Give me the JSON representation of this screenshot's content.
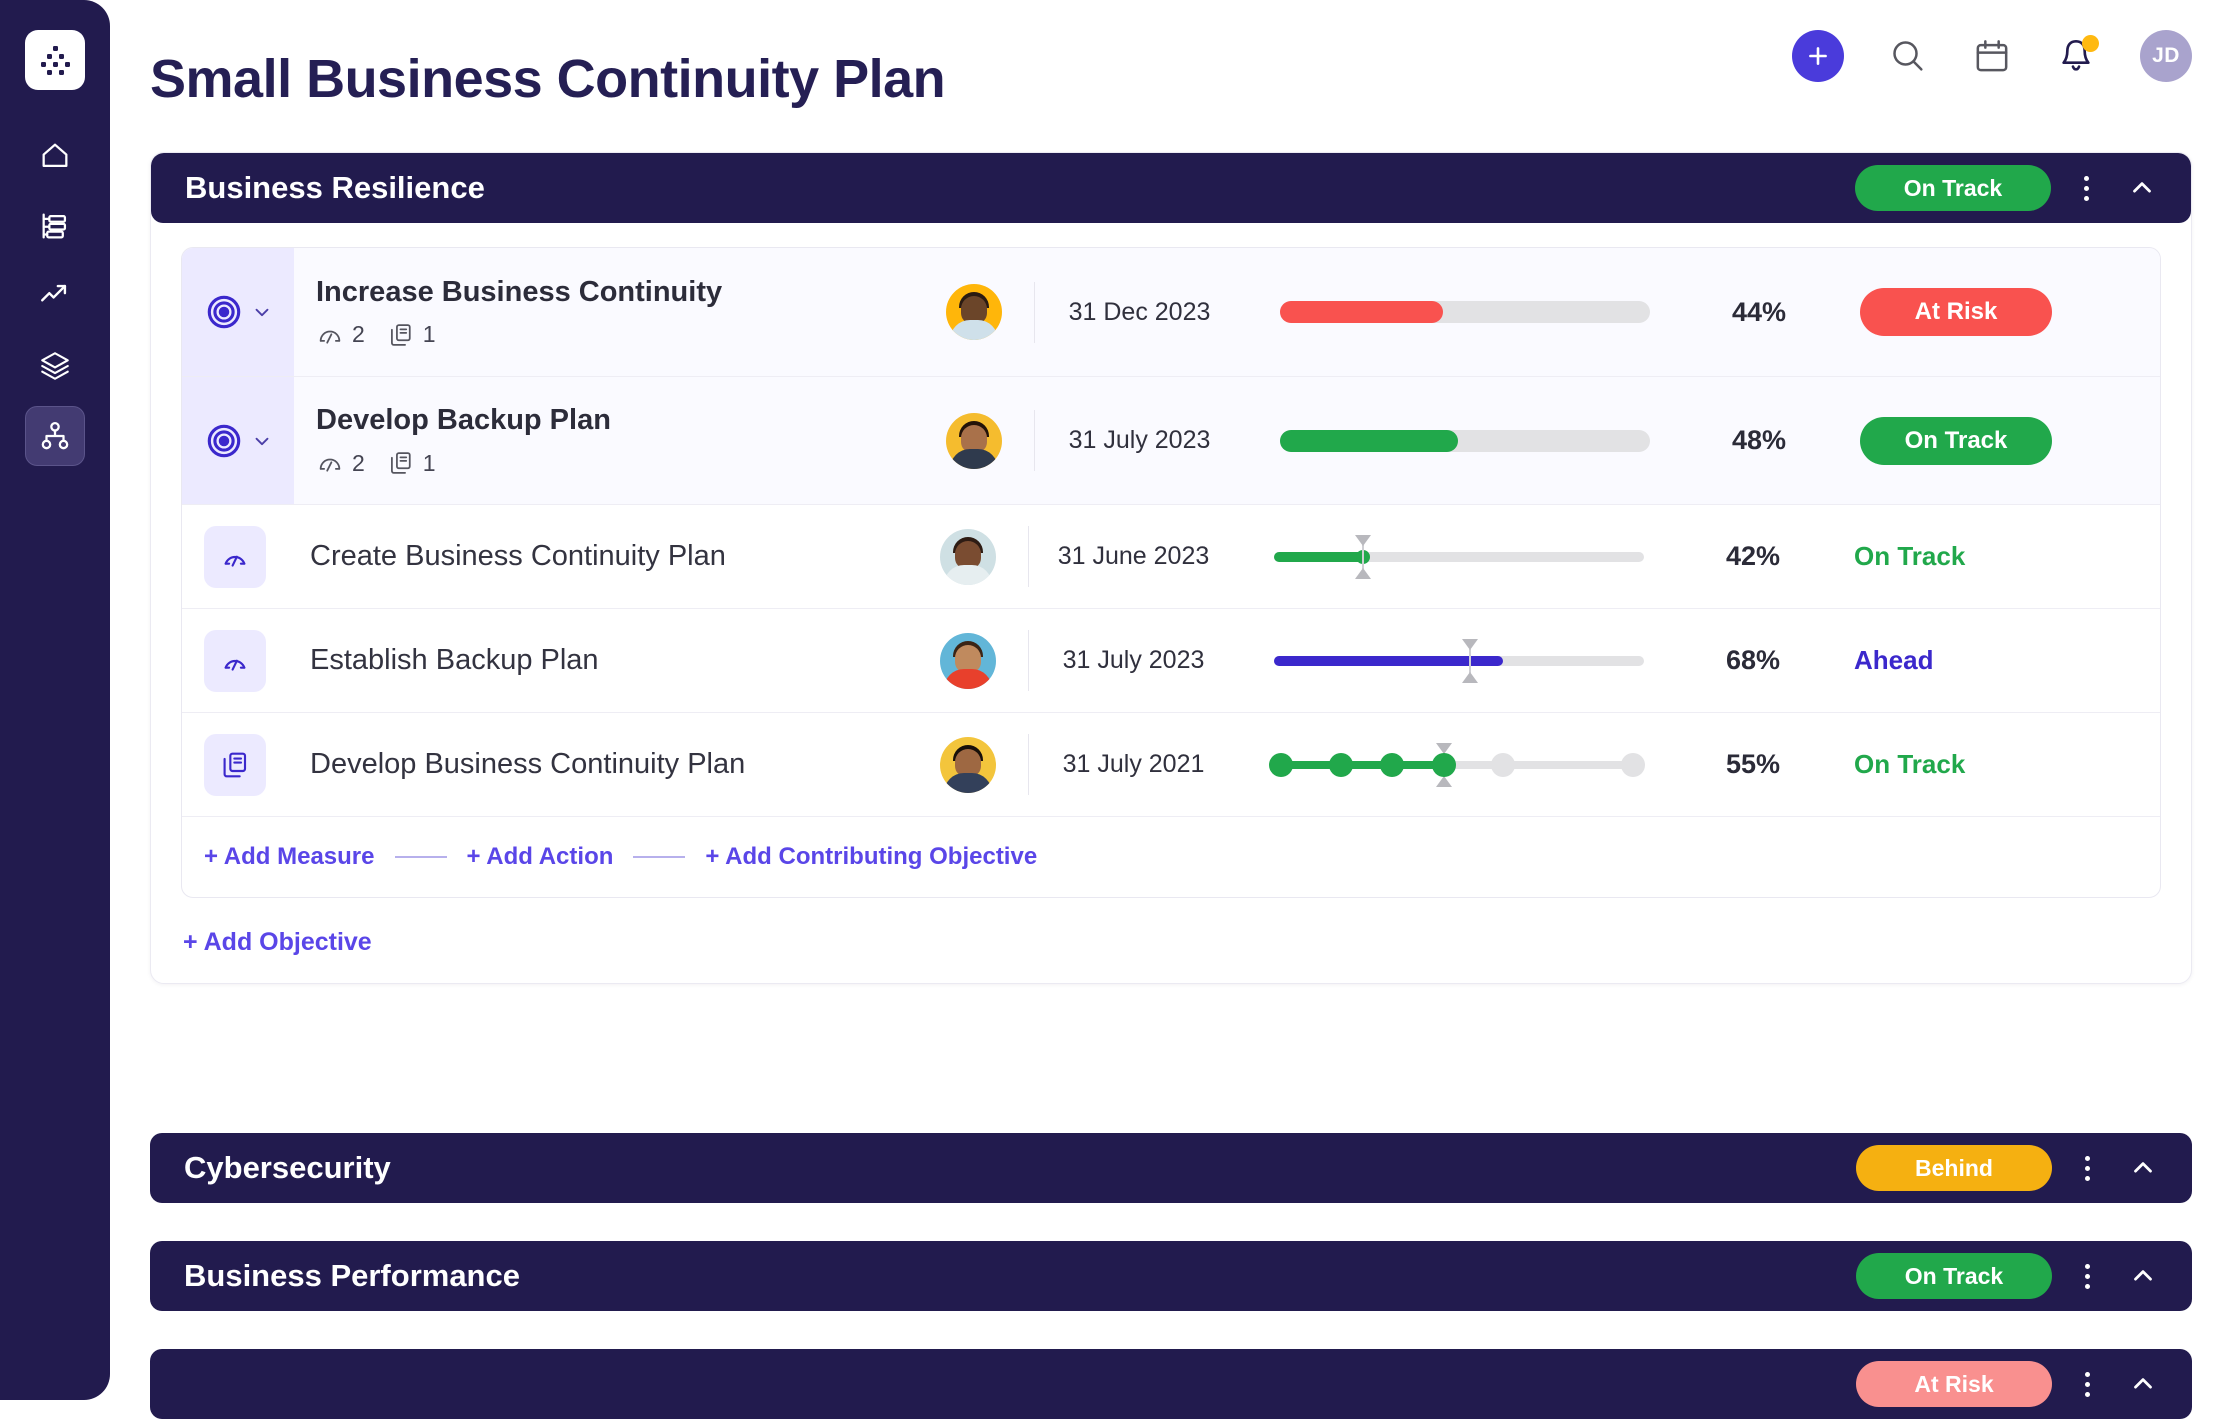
{
  "app": {
    "logo_icon": "hierarchy-logo-icon",
    "brand_color": "#221b4e",
    "accent_color": "#4a3bdb",
    "link_color": "#5a46e8"
  },
  "sidebar": {
    "items": [
      {
        "icon": "home-icon",
        "label": "Home",
        "active": false
      },
      {
        "icon": "gantt-chart-icon",
        "label": "Plans",
        "active": false
      },
      {
        "icon": "trending-up-icon",
        "label": "Performance",
        "active": false
      },
      {
        "icon": "layers-icon",
        "label": "Layers",
        "active": false
      },
      {
        "icon": "network-nodes-icon",
        "label": "Strategy Map",
        "active": true
      }
    ]
  },
  "header": {
    "title": "Small Business Continuity Plan",
    "actions": [
      {
        "icon": "plus-icon",
        "name": "add-button"
      },
      {
        "icon": "search-icon",
        "name": "search-button"
      },
      {
        "icon": "calendar-icon",
        "name": "calendar-button"
      },
      {
        "icon": "bell-icon",
        "name": "notifications-button",
        "badge": true
      }
    ],
    "avatar_initials": "JD"
  },
  "sections": [
    {
      "title": "Business Resilience",
      "status": "On Track",
      "status_style": "pill-ontrack",
      "expanded": true
    },
    {
      "title": "Cybersecurity",
      "status": "Behind",
      "status_style": "pill-behind",
      "expanded": false
    },
    {
      "title": "Business Performance",
      "status": "On Track",
      "status_style": "pill-ontrack",
      "expanded": false
    },
    {
      "title": "",
      "status": "At Risk",
      "status_style": "pill-atrisk",
      "expanded": false
    }
  ],
  "objectives": [
    {
      "icon": "target-icon",
      "name": "Increase Business Continuity",
      "measures_icon": "gauge-icon",
      "measures_count": "2",
      "actions_icon": "documents-icon",
      "actions_count": "1",
      "owner_avatar": "avatar-photo-orange",
      "due_date": "31 Dec 2023",
      "progress_pct": 44,
      "progress_label": "44%",
      "bar_color": "#f9524f",
      "status": "At Risk",
      "status_color": "#f9524f"
    },
    {
      "icon": "target-icon",
      "name": "Develop Backup Plan",
      "measures_icon": "gauge-icon",
      "measures_count": "2",
      "actions_icon": "documents-icon",
      "actions_count": "1",
      "owner_avatar": "avatar-photo-gold",
      "due_date": "31 July 2023",
      "progress_pct": 48,
      "progress_label": "48%",
      "bar_color": "#21a84b",
      "status": "On Track",
      "status_color": "#21a84b"
    }
  ],
  "children": [
    {
      "icon": "gauge-icon",
      "type": "measure",
      "name": "Create Business Continuity Plan",
      "owner_avatar": "avatar-photo-lightblue",
      "due_date": "31 June 2023",
      "progress_pct": 24,
      "target_pct": 24,
      "progress_label": "42%",
      "fill_class": "sfill-green",
      "status": "On Track",
      "status_class": "st-ontrack"
    },
    {
      "icon": "gauge-icon",
      "type": "measure",
      "name": "Establish Backup Plan",
      "owner_avatar": "avatar-photo-sky",
      "due_date": "31 July 2023",
      "progress_pct": 62,
      "target_pct": 53,
      "progress_label": "68%",
      "fill_class": "sfill-blue",
      "status": "Ahead",
      "status_class": "st-ahead"
    },
    {
      "icon": "documents-icon",
      "type": "action",
      "name": "Develop Business Continuity Plan",
      "owner_avatar": "avatar-photo-gold2",
      "due_date": "31 July 2021",
      "progress_pct": 46,
      "target_pct": 46,
      "progress_label": "55%",
      "milestones": [
        {
          "pos": 2,
          "done": true
        },
        {
          "pos": 18,
          "done": true
        },
        {
          "pos": 32,
          "done": true
        },
        {
          "pos": 46,
          "done": true
        },
        {
          "pos": 62,
          "done": false
        },
        {
          "pos": 97,
          "done": false
        }
      ],
      "status": "On Track",
      "status_class": "st-ontrack"
    }
  ],
  "add_links": {
    "measure": "+ Add Measure",
    "action": "+ Add Action",
    "contributing_objective": "+ Add Contributing Objective",
    "objective": "+ Add Objective"
  }
}
